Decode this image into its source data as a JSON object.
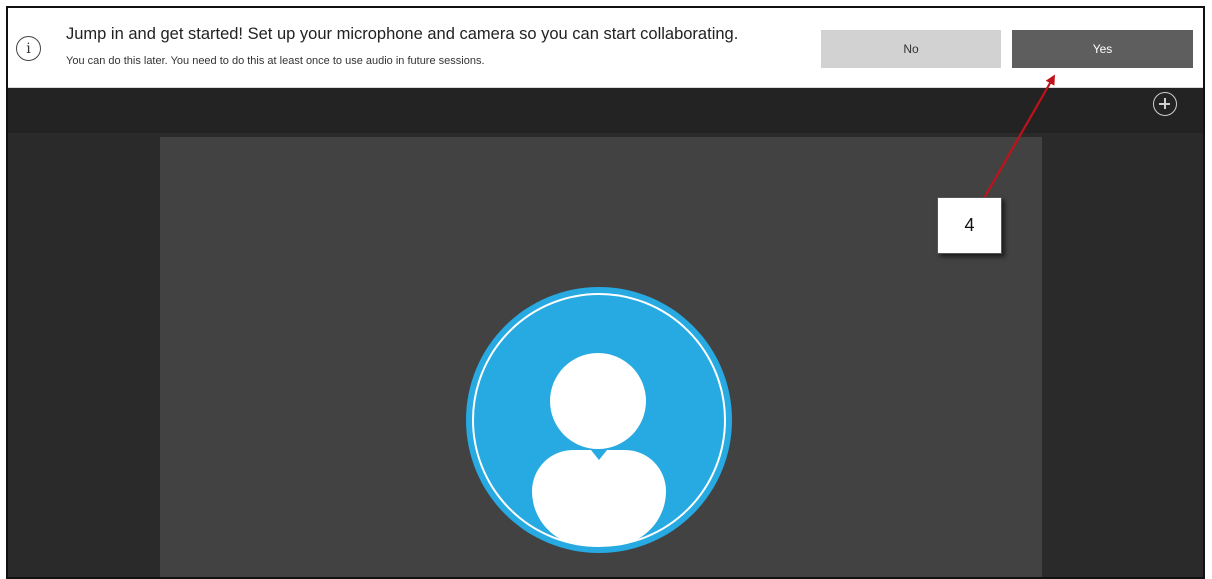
{
  "banner": {
    "icon": "info-icon",
    "title": "Jump in and get started! Set up your microphone and camera so you can start collaborating.",
    "subtitle": "You can do this later. You need to do this at least once to use audio in future sessions.",
    "no_label": "No",
    "yes_label": "Yes"
  },
  "toolbar": {
    "add_icon": "plus-circle-icon"
  },
  "stage": {
    "avatar_icon": "user-avatar-icon"
  },
  "annotation": {
    "step_label": "4",
    "arrow_color": "#c0121b"
  },
  "colors": {
    "accent": "#27a9e1",
    "yes_button": "#5e5e5e",
    "no_button": "#d2d2d2",
    "stage_background": "#424242",
    "app_background": "#2a2a2a"
  }
}
